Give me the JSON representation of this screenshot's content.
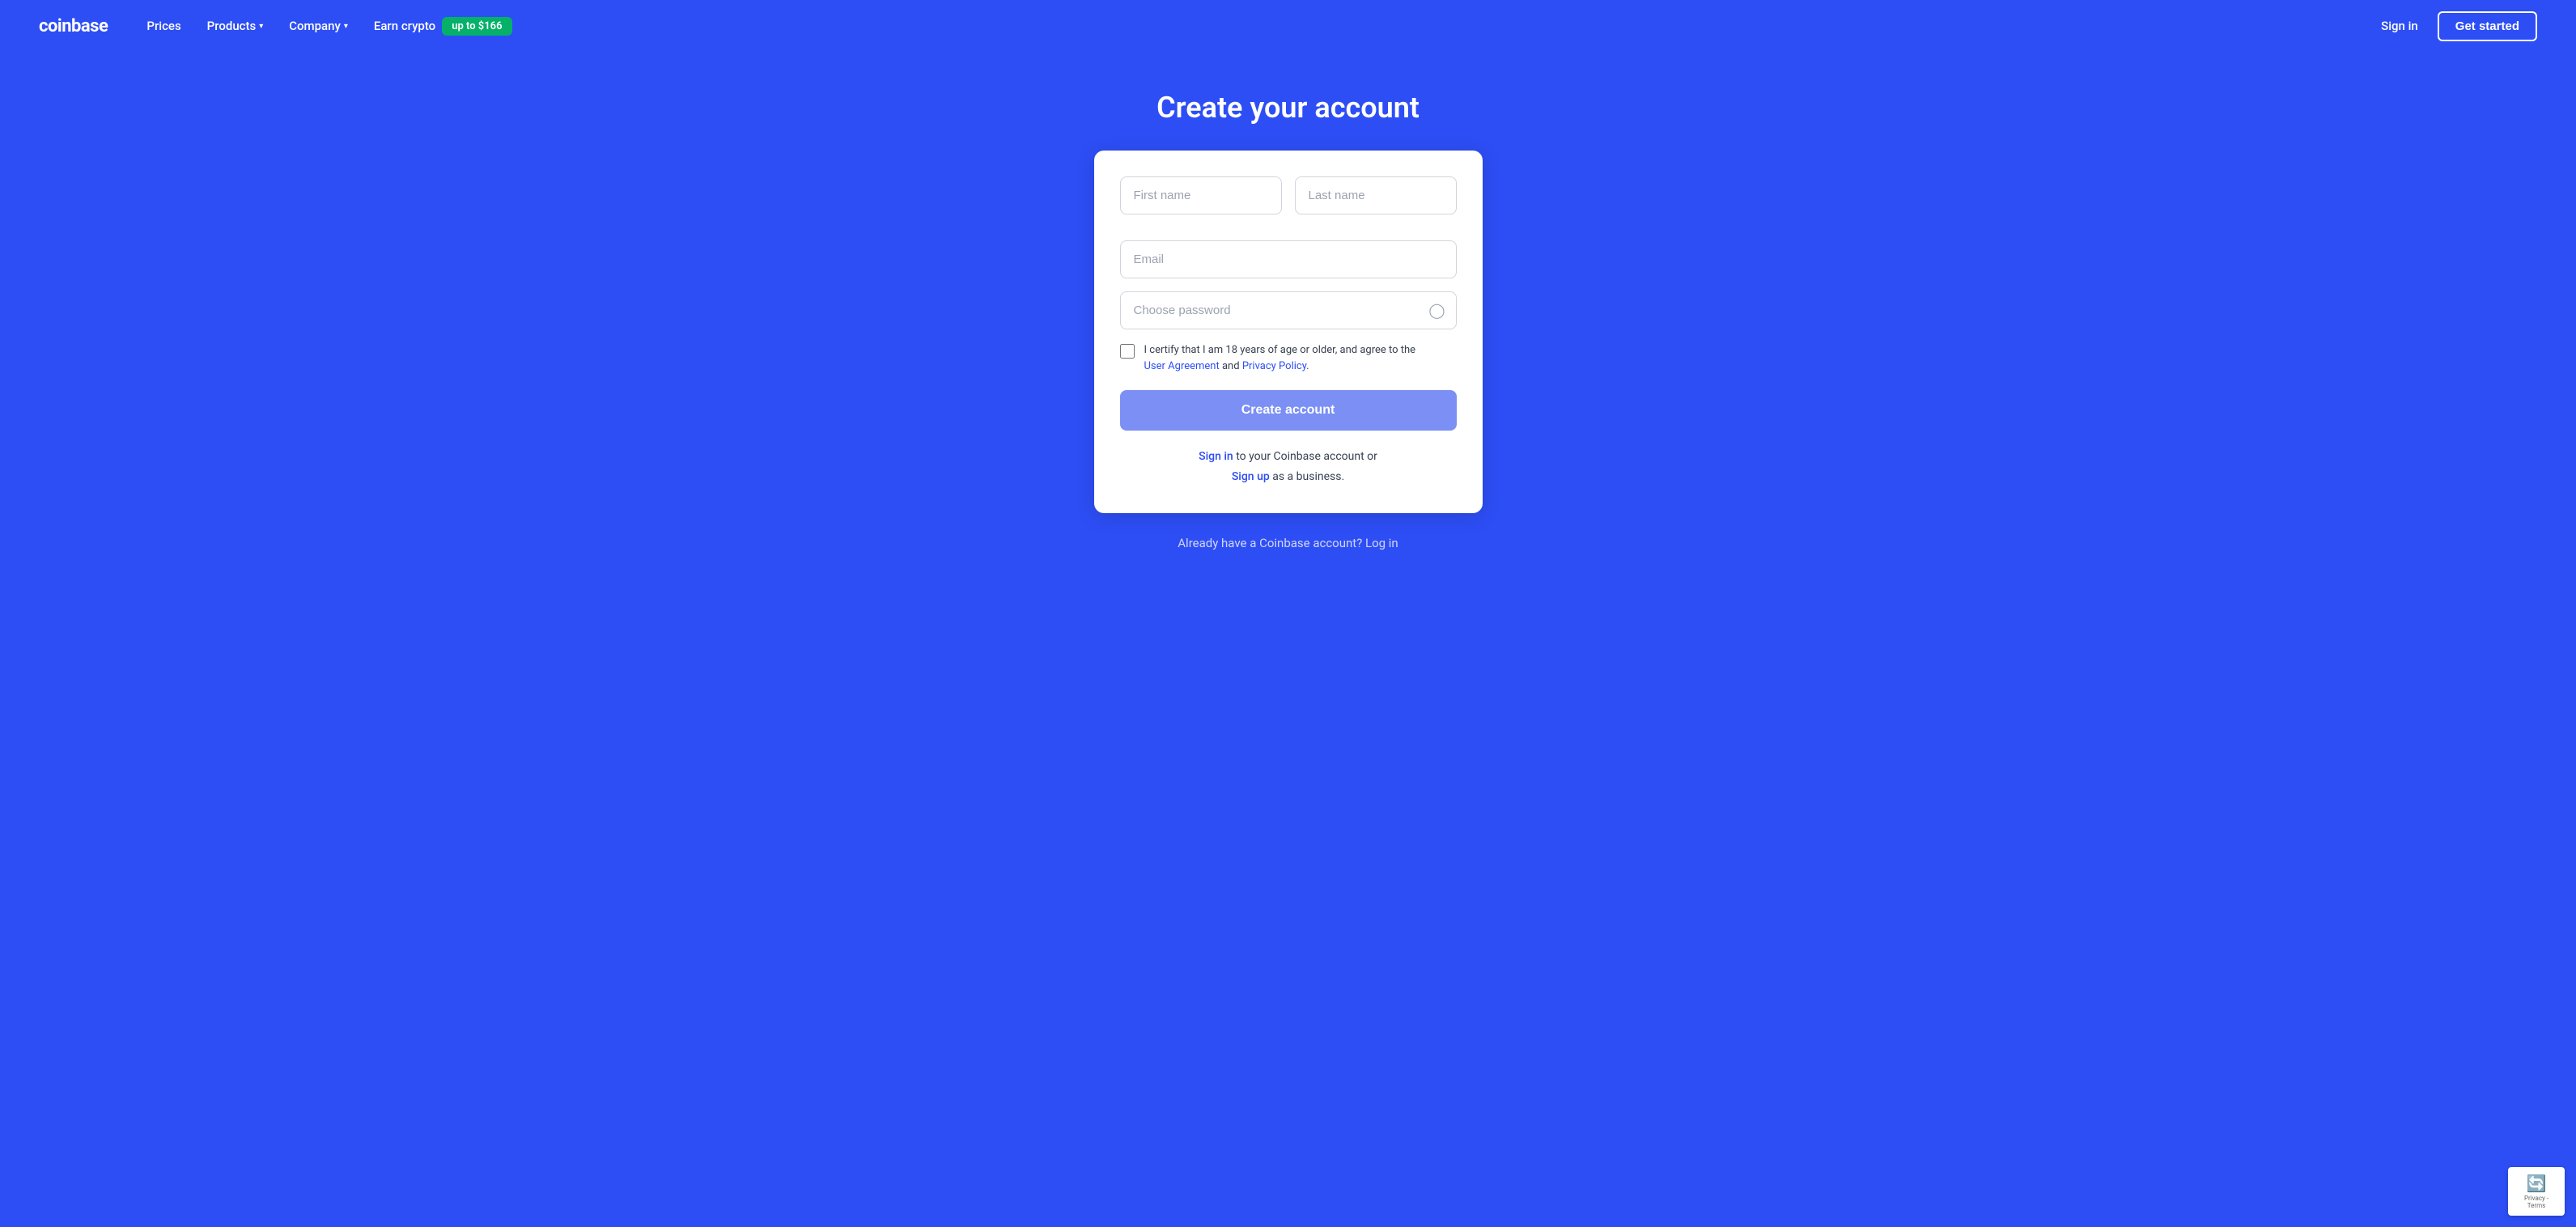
{
  "navbar": {
    "logo": "coinbase",
    "nav_items": [
      {
        "label": "Prices",
        "has_dropdown": false
      },
      {
        "label": "Products",
        "has_dropdown": true
      },
      {
        "label": "Company",
        "has_dropdown": true
      }
    ],
    "earn_crypto": "Earn crypto",
    "earn_badge": "up to $166",
    "sign_in": "Sign in",
    "get_started": "Get started"
  },
  "page": {
    "title": "Create your account"
  },
  "form": {
    "first_name_placeholder": "First name",
    "last_name_placeholder": "Last name",
    "email_placeholder": "Email",
    "password_placeholder": "Choose password",
    "checkbox_text": "I certify that I am 18 years of age or older, and agree to the",
    "user_agreement_label": "User Agreement",
    "and_text": "and",
    "privacy_policy_label": "Privacy Policy",
    "period": ".",
    "create_account_btn": "Create account",
    "sign_in_text": "to your Coinbase account or",
    "sign_in_link": "Sign in",
    "sign_up_link": "Sign up",
    "sign_up_text": "as a business."
  },
  "bottom": {
    "text": "Already have a Coinbase account? Log in"
  },
  "icons": {
    "chevron": "▾",
    "eye": "○"
  }
}
